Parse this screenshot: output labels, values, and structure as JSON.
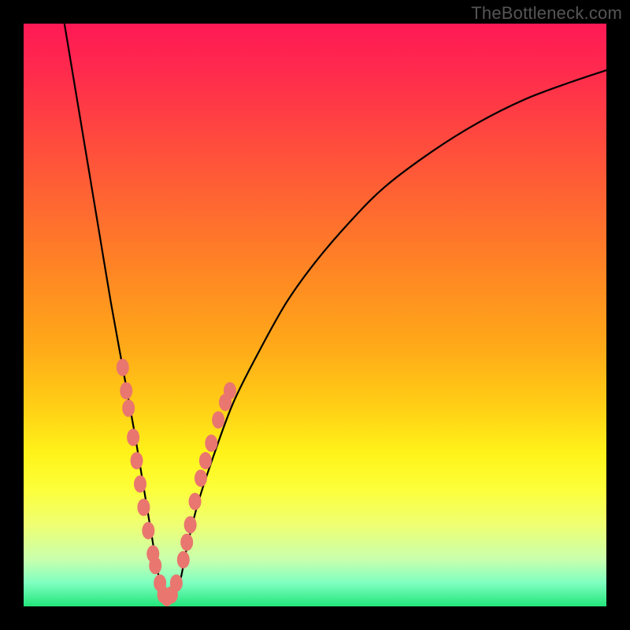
{
  "watermark": "TheBottleneck.com",
  "colors": {
    "frame": "#000000",
    "curve": "#000000",
    "dot": "#e9766f",
    "gradient_top": "#ff1955",
    "gradient_bottom": "#22e57a"
  },
  "chart_data": {
    "type": "line",
    "title": "",
    "xlabel": "",
    "ylabel": "",
    "xlim": [
      0,
      100
    ],
    "ylim": [
      0,
      100
    ],
    "grid": false,
    "legend": false,
    "description": "V-shaped bottleneck curve over a vertical red-to-green gradient. Low y = green (good / no bottleneck), high y = red (severe bottleneck). Left arm is steep, right arm is gradual. Minimum near x≈24.",
    "series": [
      {
        "name": "bottleneck-curve",
        "x": [
          7,
          9,
          11,
          13,
          15,
          17,
          19,
          21,
          22,
          23,
          24,
          25,
          26,
          27,
          28,
          30,
          33,
          36,
          40,
          45,
          50,
          56,
          62,
          70,
          78,
          86,
          94,
          100
        ],
        "y": [
          100,
          88,
          76,
          64,
          52,
          41,
          30,
          18,
          12,
          6,
          2,
          1,
          2,
          5,
          10,
          18,
          27,
          35,
          43,
          52,
          59,
          66,
          72,
          78,
          83,
          87,
          90,
          92
        ]
      }
    ],
    "annotations_along_curve": [
      {
        "x": 17.0,
        "y": 41
      },
      {
        "x": 17.6,
        "y": 37
      },
      {
        "x": 18.0,
        "y": 34
      },
      {
        "x": 18.8,
        "y": 29
      },
      {
        "x": 19.4,
        "y": 25
      },
      {
        "x": 20.0,
        "y": 21
      },
      {
        "x": 20.6,
        "y": 17
      },
      {
        "x": 21.4,
        "y": 13
      },
      {
        "x": 22.2,
        "y": 9
      },
      {
        "x": 22.6,
        "y": 7
      },
      {
        "x": 23.4,
        "y": 4
      },
      {
        "x": 24.0,
        "y": 2
      },
      {
        "x": 24.6,
        "y": 1.5
      },
      {
        "x": 25.4,
        "y": 2
      },
      {
        "x": 26.2,
        "y": 4
      },
      {
        "x": 27.4,
        "y": 8
      },
      {
        "x": 28.0,
        "y": 11
      },
      {
        "x": 28.6,
        "y": 14
      },
      {
        "x": 29.4,
        "y": 18
      },
      {
        "x": 30.4,
        "y": 22
      },
      {
        "x": 31.2,
        "y": 25
      },
      {
        "x": 32.2,
        "y": 28
      },
      {
        "x": 33.4,
        "y": 32
      },
      {
        "x": 34.6,
        "y": 35
      },
      {
        "x": 35.4,
        "y": 37
      }
    ]
  }
}
